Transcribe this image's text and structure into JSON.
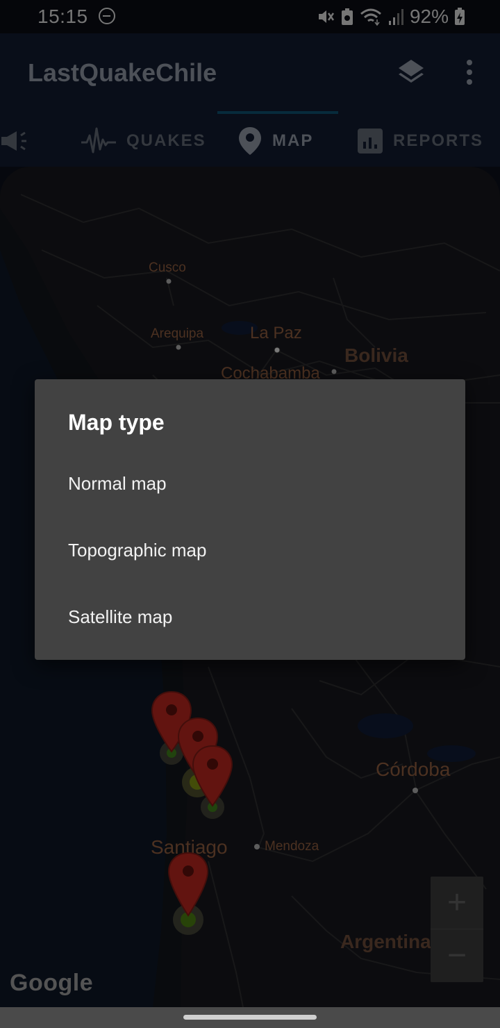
{
  "status_bar": {
    "time": "15:15",
    "battery_percent": "92%",
    "icons": [
      "dnd-icon",
      "mute-icon",
      "battery-saver-icon",
      "wifi-icon",
      "signal-icon",
      "battery-icon"
    ]
  },
  "app_bar": {
    "title": "LastQuakeChile",
    "actions": [
      "layers-icon",
      "overflow-menu-icon"
    ]
  },
  "tabs": [
    {
      "label": "",
      "icon": "megaphone-icon"
    },
    {
      "label": "QUAKES",
      "icon": "seismograph-icon"
    },
    {
      "label": "MAP",
      "icon": "map-pin-icon",
      "active": true
    },
    {
      "label": "REPORTS",
      "icon": "bar-chart-icon"
    }
  ],
  "map": {
    "labels": {
      "cusco": "Cusco",
      "arequipa": "Arequipa",
      "la_paz": "La Paz",
      "bolivia": "Bolivia",
      "cochabamba": "Cochabamba",
      "cordoba": "Córdoba",
      "santiago": "Santiago",
      "mendoza": "Mendoza",
      "argentina": "Argentina"
    },
    "zoom_in": "+",
    "zoom_out": "−",
    "attribution": "Google",
    "marker_count": 4
  },
  "dialog": {
    "title": "Map type",
    "options": [
      "Normal map",
      "Topographic map",
      "Satellite map"
    ]
  },
  "colors": {
    "app_bar": "#111a2e",
    "dialog": "#424242",
    "marker": "#b3261e"
  }
}
